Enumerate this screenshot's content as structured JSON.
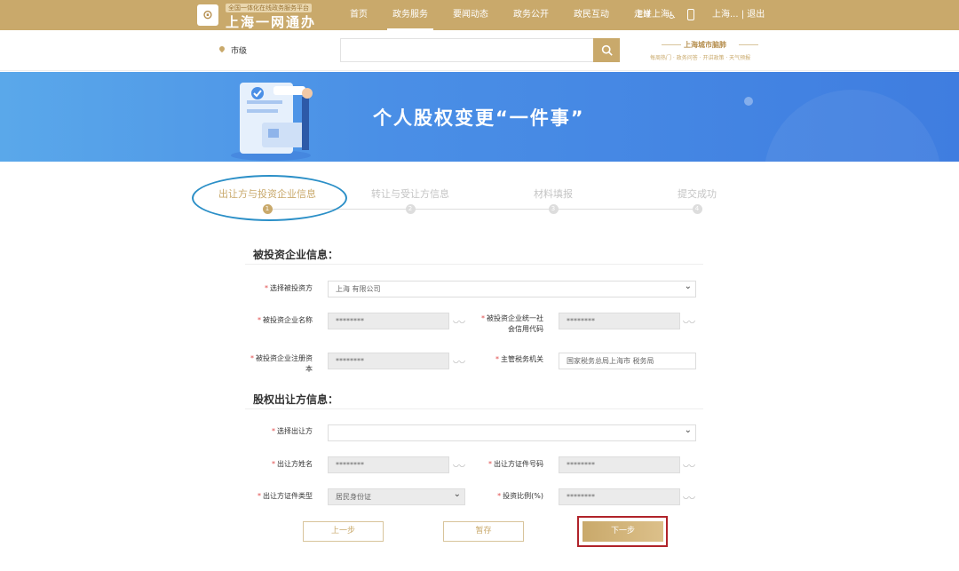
{
  "header": {
    "logo_tag": "全国一体化在线政务服务平台",
    "logo_title": "上海一网通办",
    "nav_items": [
      "首页",
      "政务服务",
      "要闻动态",
      "政务公开",
      "政民互动",
      "走进上海"
    ],
    "active_nav": "政务服务",
    "lang": "EN",
    "user": "上海...",
    "logout": "退出",
    "accent_color": "#c9a96b"
  },
  "search": {
    "location": "市级",
    "placeholder": "",
    "city_brain_title": "上海城市脑肺",
    "city_brain_sub": "每周热门 · 政务问答 · 开讲政策 · 天气预报"
  },
  "banner": {
    "title": "个人股权变更“一件事”"
  },
  "steps": [
    {
      "label": "出让方与投资企业信息",
      "num": "1"
    },
    {
      "label": "转让与受让方信息",
      "num": "2"
    },
    {
      "label": "材料填报",
      "num": "3"
    },
    {
      "label": "提交成功",
      "num": "4"
    }
  ],
  "section1": {
    "title": "被投资企业信息：",
    "select_investee_label": "选择被投资方",
    "select_investee_value": "上海                    有限公司",
    "name_label": "被投资企业名称",
    "name_value": "********",
    "credit_code_label_1": "被投资企业统一社",
    "credit_code_label_2": "会信用代码",
    "credit_code_value": "********",
    "capital_label_1": "被投资企业注册资",
    "capital_label_2": "本",
    "capital_value": "********",
    "tax_office_label": "主管税务机关",
    "tax_office_value": "国家税务总局上海市           税务局"
  },
  "section2": {
    "title": "股权出让方信息：",
    "select_transferor_label": "选择出让方",
    "select_transferor_value": "",
    "transferor_name_label": "出让方姓名",
    "transferor_name_value": "********",
    "id_number_label": "出让方证件号码",
    "id_number_value": "********",
    "id_type_label": "出让方证件类型",
    "id_type_value": "居民身份证",
    "ratio_label": "投资比例(%)",
    "ratio_value": "********"
  },
  "buttons": {
    "prev": "上一步",
    "save": "暂存",
    "next": "下一步"
  }
}
